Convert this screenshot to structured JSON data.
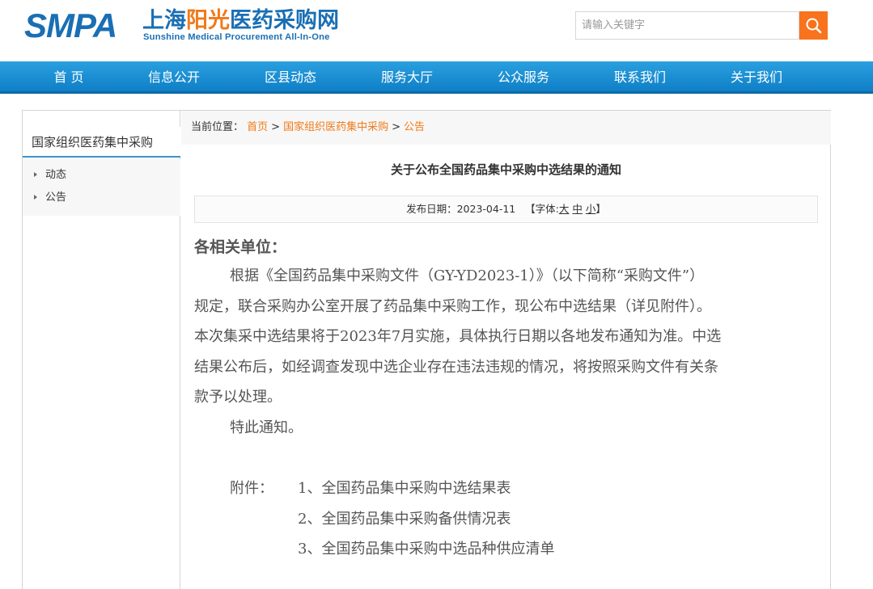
{
  "header": {
    "logo_smpa": "SMPA",
    "logo_cn_blue": "上海",
    "logo_cn_orange": "阳光",
    "logo_cn_rest": "医药采购网",
    "logo_en": "Sunshine Medical Procurement All-In-One",
    "search_placeholder": "请输入关键字"
  },
  "nav": {
    "items": [
      "首 页",
      "信息公开",
      "区县动态",
      "服务大厅",
      "公众服务",
      "联系我们",
      "关于我们"
    ]
  },
  "sidebar": {
    "title": "国家组织医药集中采购",
    "items": [
      "动态",
      "公告"
    ]
  },
  "breadcrumb": {
    "label": "当前位置：",
    "links": [
      "首页",
      "国家组织医药集中采购",
      "公告"
    ],
    "separator": ">"
  },
  "article": {
    "title": "关于公布全国药品集中采购中选结果的通知",
    "date_label": "发布日期：",
    "date": "2023-04-11",
    "font_label": "【字体:",
    "font_sizes": [
      "大",
      "中",
      "小"
    ],
    "font_close": "】",
    "greeting": "各相关单位：",
    "lines": [
      "根据《全国药品集中采购文件（GY-YD2023-1）》（以下简称“采购文件”）",
      "规定，联合采购办公室开展了药品集中采购工作，现公布中选结果（详见附件）。",
      "本次集采中选结果将于2023年7月实施，具体执行日期以各地发布通知为准。中选",
      "结果公布后，如经调查发现中选企业存在违法违规的情况，将按照采购文件有关条",
      "款予以处理。"
    ],
    "notice": "特此通知。",
    "attachment_label": "附件：",
    "attachments": [
      "1、全国药品集中采购中选结果表",
      "2、全国药品集中采购备供情况表",
      "3、全国药品集中采购中选品种供应清单"
    ]
  },
  "colors": {
    "brand_blue": "#1a6fb4",
    "brand_orange": "#f07a1a",
    "nav_blue": "#1a8fd4",
    "search_button": "#f7731e"
  }
}
